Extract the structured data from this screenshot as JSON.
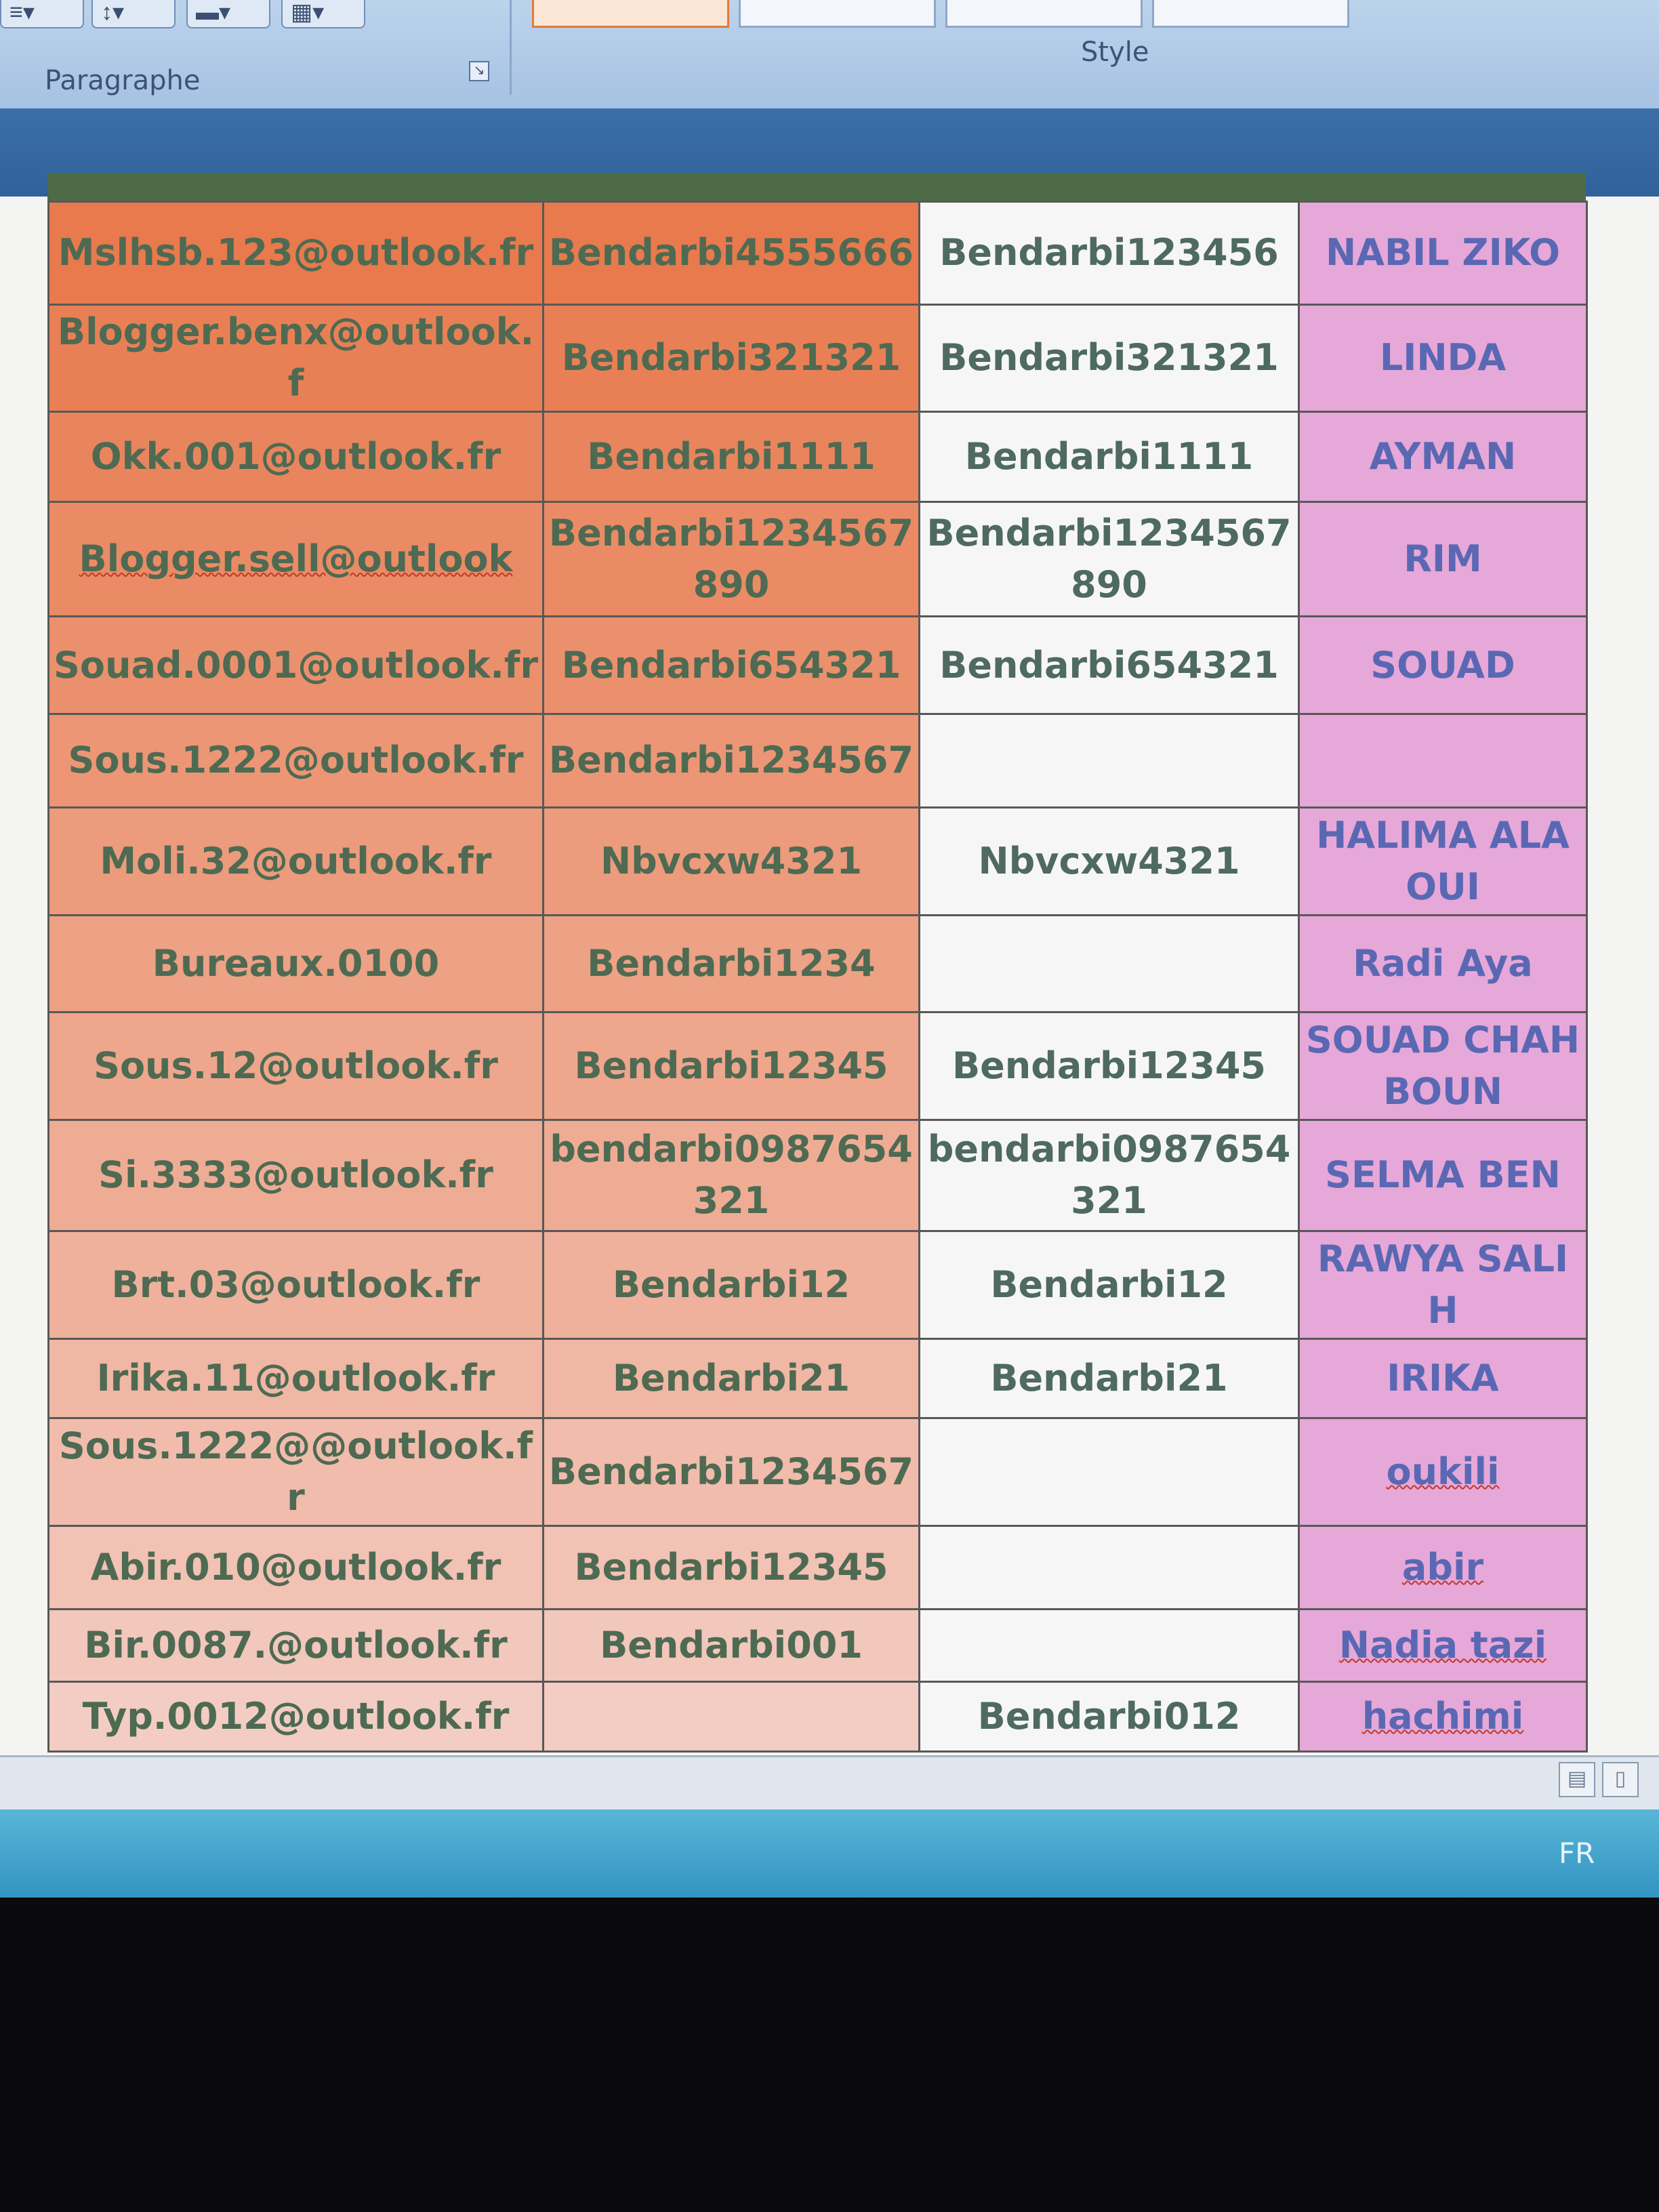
{
  "ribbon": {
    "groups": [
      {
        "label": "Paragraphe"
      },
      {
        "label": "Style"
      }
    ]
  },
  "colors": {
    "email_col_top": "#e87a4d",
    "email_col_bottom": "#f3cdc4",
    "name_col": "#e6a8d8",
    "password_col": "#f7f6f6",
    "text_green": "#4e6a52",
    "text_blue": "#5a68b4"
  },
  "table": {
    "rows": [
      {
        "email": "Mslhsb.123@outlook.fr",
        "pass1": "Bendarbi4555666",
        "pass2": "Bendarbi123456",
        "name": "NABIL ZIKO"
      },
      {
        "email": "Blogger.benx@outlook.f",
        "pass1": "Bendarbi321321",
        "pass2": "Bendarbi321321",
        "name": "LINDA"
      },
      {
        "email": "Okk.001@outlook.fr",
        "pass1": "Bendarbi1111",
        "pass2": "Bendarbi1111",
        "name": "AYMAN"
      },
      {
        "email": "Blogger.sell@outlook",
        "pass1": "Bendarbi1234567890",
        "pass2": "Bendarbi1234567890",
        "name": "RIM"
      },
      {
        "email": "Souad.0001@outlook.fr",
        "pass1": "Bendarbi654321",
        "pass2": "Bendarbi654321",
        "name": "SOUAD"
      },
      {
        "email": "Sous.1222@outlook.fr",
        "pass1": "Bendarbi1234567",
        "pass2": "",
        "name": ""
      },
      {
        "email": "Moli.32@outlook.fr",
        "pass1": "Nbvcxw4321",
        "pass2": "Nbvcxw4321",
        "name": "HALIMA ALAOUI"
      },
      {
        "email": "Bureaux.0100",
        "pass1": "Bendarbi1234",
        "pass2": "",
        "name": "Radi Aya"
      },
      {
        "email": "Sous.12@outlook.fr",
        "pass1": "Bendarbi12345",
        "pass2": "Bendarbi12345",
        "name": "SOUAD CHAHBOUN"
      },
      {
        "email": "Si.3333@outlook.fr",
        "pass1": "bendarbi0987654321",
        "pass2": "bendarbi0987654321",
        "name": "SELMA BEN"
      },
      {
        "email": "Brt.03@outlook.fr",
        "pass1": "Bendarbi12",
        "pass2": "Bendarbi12",
        "name": "RAWYA SALIH"
      },
      {
        "email": "Irika.11@outlook.fr",
        "pass1": "Bendarbi21",
        "pass2": "Bendarbi21",
        "name": "IRIKA"
      },
      {
        "email": "Sous.1222@@outlook.fr",
        "pass1": "Bendarbi1234567",
        "pass2": "",
        "name": "oukili"
      },
      {
        "email": "Abir.010@outlook.fr",
        "pass1": "Bendarbi12345",
        "pass2": "",
        "name": "abir"
      },
      {
        "email": "Bir.0087.@outlook.fr",
        "pass1": "Bendarbi001",
        "pass2": "",
        "name": "Nadia tazi"
      },
      {
        "email": "Typ.0012@outlook.fr",
        "pass1": "",
        "pass2": "Bendarbi012",
        "name": "hachimi"
      }
    ]
  },
  "taskbar": {
    "language": "FR"
  }
}
